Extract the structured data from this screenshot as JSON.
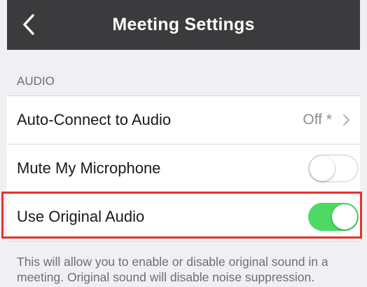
{
  "header": {
    "title": "Meeting Settings",
    "back_icon": "chevron-left-icon"
  },
  "section": {
    "label": "AUDIO"
  },
  "rows": [
    {
      "label": "Auto-Connect to Audio",
      "value": "Off *",
      "control": "chevron-right-icon"
    },
    {
      "label": "Mute My Microphone",
      "control": "toggle",
      "toggle_on": false
    },
    {
      "label": "Use Original Audio",
      "control": "toggle",
      "toggle_on": true,
      "highlighted": true
    }
  ],
  "footer": {
    "note": "This will allow you to enable or disable original sound in a meeting. Original sound will disable noise suppression."
  },
  "colors": {
    "header_bg": "#3b3b3d",
    "toggle_on": "#4cd964",
    "highlight_border": "#e8302a",
    "page_bg": "#f0f0f4"
  }
}
